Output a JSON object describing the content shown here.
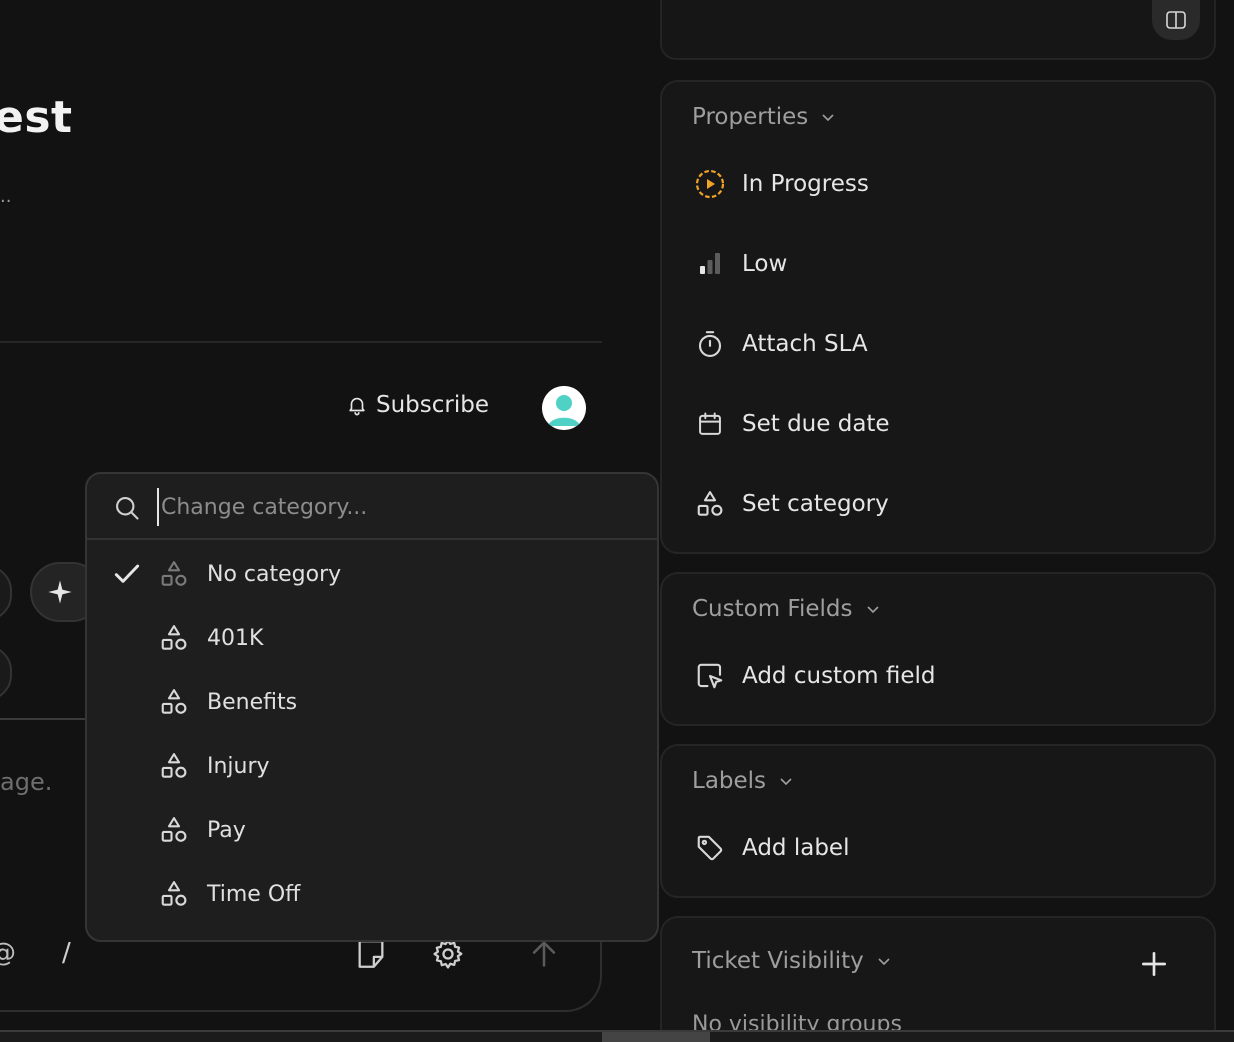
{
  "main": {
    "title": "est",
    "title_ellipsis": "..",
    "subscribe_label": "Subscribe",
    "composer_placeholder": "age.",
    "composer_at": "@",
    "composer_slash": "/"
  },
  "dropdown": {
    "search_placeholder": "Change category...",
    "items": [
      {
        "label": "No category",
        "selected": true
      },
      {
        "label": "401K",
        "selected": false
      },
      {
        "label": "Benefits",
        "selected": false
      },
      {
        "label": "Injury",
        "selected": false
      },
      {
        "label": "Pay",
        "selected": false
      },
      {
        "label": "Time Off",
        "selected": false
      }
    ]
  },
  "properties": {
    "header": "Properties",
    "status": "In Progress",
    "priority": "Low",
    "sla": "Attach SLA",
    "due_date": "Set due date",
    "category": "Set category"
  },
  "custom_fields": {
    "header": "Custom Fields",
    "add_label": "Add custom field"
  },
  "labels": {
    "header": "Labels",
    "add_label": "Add label"
  },
  "ticket_visibility": {
    "header": "Ticket Visibility",
    "empty_text": "No visibility groups"
  },
  "colors": {
    "accent_status": "#f0a326",
    "avatar": "#4fd1c5"
  }
}
